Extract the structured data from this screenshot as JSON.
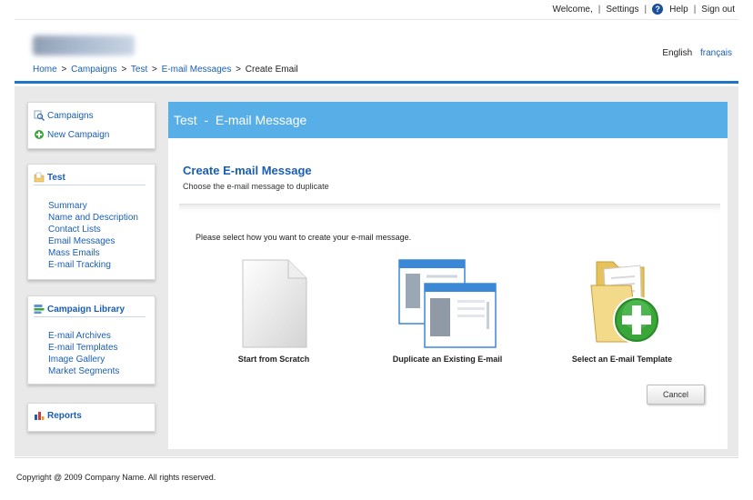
{
  "topbar": {
    "welcome": "Welcome,",
    "settings": "Settings",
    "help": "Help",
    "signout": "Sign out",
    "sep": "|"
  },
  "header": {
    "breadcrumb": [
      "Home",
      "Campaigns",
      "Test",
      "E-mail Messages",
      "Create Email"
    ],
    "crumb_sep": ">",
    "lang_current": "English",
    "lang_other": "français"
  },
  "sidebar": {
    "nav": {
      "campaigns": "Campaigns",
      "new_campaign": "New Campaign"
    },
    "test": {
      "title": "Test",
      "items": [
        "Summary",
        "Name and Description",
        "Contact Lists",
        "Email Messages",
        "Mass Emails",
        "E-mail Tracking"
      ]
    },
    "library": {
      "title": "Campaign Library",
      "items": [
        "E-mail Archives",
        "E-mail Templates",
        "Image Gallery",
        "Market Segments"
      ]
    },
    "reports": {
      "title": "Reports"
    }
  },
  "main": {
    "header": "Test  -  E-mail Message",
    "title": "Create E-mail Message",
    "subtitle": "Choose the e-mail message to duplicate",
    "prompt": "Please select how you want to create your e-mail message.",
    "options": [
      {
        "label": "Start from Scratch",
        "icon": "blank-page-icon"
      },
      {
        "label": "Duplicate an Existing E-mail",
        "icon": "duplicate-windows-icon"
      },
      {
        "label": "Select an E-mail Template",
        "icon": "folder-add-icon"
      }
    ],
    "cancel": "Cancel"
  },
  "footer": {
    "copyright": "Copyright @ 2009 Company Name. All rights reserved."
  },
  "colors": {
    "accent": "#1e74c8",
    "panel_header": "#58aee6",
    "link": "#1a5eb4",
    "add_green": "#3aa63a"
  }
}
